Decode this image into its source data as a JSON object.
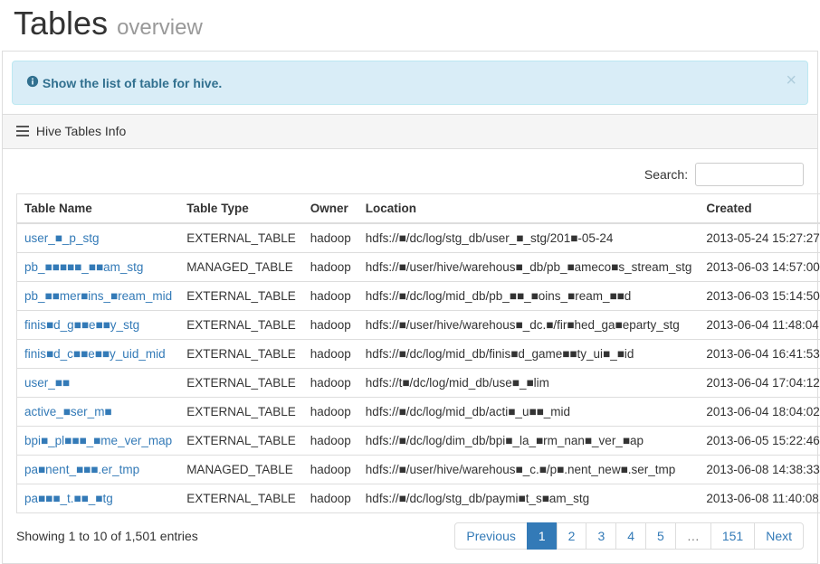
{
  "header": {
    "title": "Tables",
    "subtitle": "overview"
  },
  "alert": {
    "icon": "info-icon",
    "text": "Show the list of table for hive."
  },
  "panel": {
    "title": "Hive Tables Info"
  },
  "search": {
    "label": "Search:",
    "value": ""
  },
  "table": {
    "columns": [
      "Table Name",
      "Table Type",
      "Owner",
      "Location",
      "Created"
    ],
    "rows": [
      {
        "name": "user_■_p_stg",
        "type": "EXTERNAL_TABLE",
        "owner": "hadoop",
        "location": "hdfs://■/dc/log/stg_db/user_■_stg/201■-05-24",
        "created": "2013-05-24 15:27:27"
      },
      {
        "name": "pb_■■■■■_■■am_stg",
        "type": "MANAGED_TABLE",
        "owner": "hadoop",
        "location": "hdfs://■/user/hive/warehous■_db/pb_■ameco■s_stream_stg",
        "created": "2013-06-03 14:57:00"
      },
      {
        "name": "pb_■■mer■ins_■ream_mid",
        "type": "EXTERNAL_TABLE",
        "owner": "hadoop",
        "location": "hdfs://■/dc/log/mid_db/pb_■■_■oins_■ream_■■d",
        "created": "2013-06-03 15:14:50"
      },
      {
        "name": "finis■d_g■■e■■y_stg",
        "type": "EXTERNAL_TABLE",
        "owner": "hadoop",
        "location": "hdfs://■/user/hive/warehous■_dc.■/fir■hed_ga■eparty_stg",
        "created": "2013-06-04 11:48:04"
      },
      {
        "name": "finis■d_c■■e■■y_uid_mid",
        "type": "EXTERNAL_TABLE",
        "owner": "hadoop",
        "location": "hdfs://■/dc/log/mid_db/finis■d_game■■ty_ui■_■id",
        "created": "2013-06-04 16:41:53"
      },
      {
        "name": "user_■■",
        "type": "EXTERNAL_TABLE",
        "owner": "hadoop",
        "location": "hdfs://t■/dc/log/mid_db/use■_■lim",
        "created": "2013-06-04 17:04:12"
      },
      {
        "name": "active_■ser_m■",
        "type": "EXTERNAL_TABLE",
        "owner": "hadoop",
        "location": "hdfs://■/dc/log/mid_db/acti■_u■■_mid",
        "created": "2013-06-04 18:04:02"
      },
      {
        "name": "bpi■_pl■■■_■me_ver_map",
        "type": "EXTERNAL_TABLE",
        "owner": "hadoop",
        "location": "hdfs://■/dc/log/dim_db/bpi■_la_■rm_nan■_ver_■ap",
        "created": "2013-06-05 15:22:46"
      },
      {
        "name": "pa■nent_■■■.er_tmp",
        "type": "MANAGED_TABLE",
        "owner": "hadoop",
        "location": "hdfs://■/user/hive/warehous■_c.■/p■.nent_new■.ser_tmp",
        "created": "2013-06-08 14:38:33"
      },
      {
        "name": "pa■■■_t.■■_■tg",
        "type": "EXTERNAL_TABLE",
        "owner": "hadoop",
        "location": "hdfs://■/dc/log/stg_db/paymi■t_s■am_stg",
        "created": "2013-06-08 11:40:08"
      }
    ]
  },
  "info": "Showing 1 to 10 of 1,501 entries",
  "pagination": {
    "previous": "Previous",
    "next": "Next",
    "pages": [
      "1",
      "2",
      "3",
      "4",
      "5",
      "…",
      "151"
    ],
    "active": 0
  }
}
